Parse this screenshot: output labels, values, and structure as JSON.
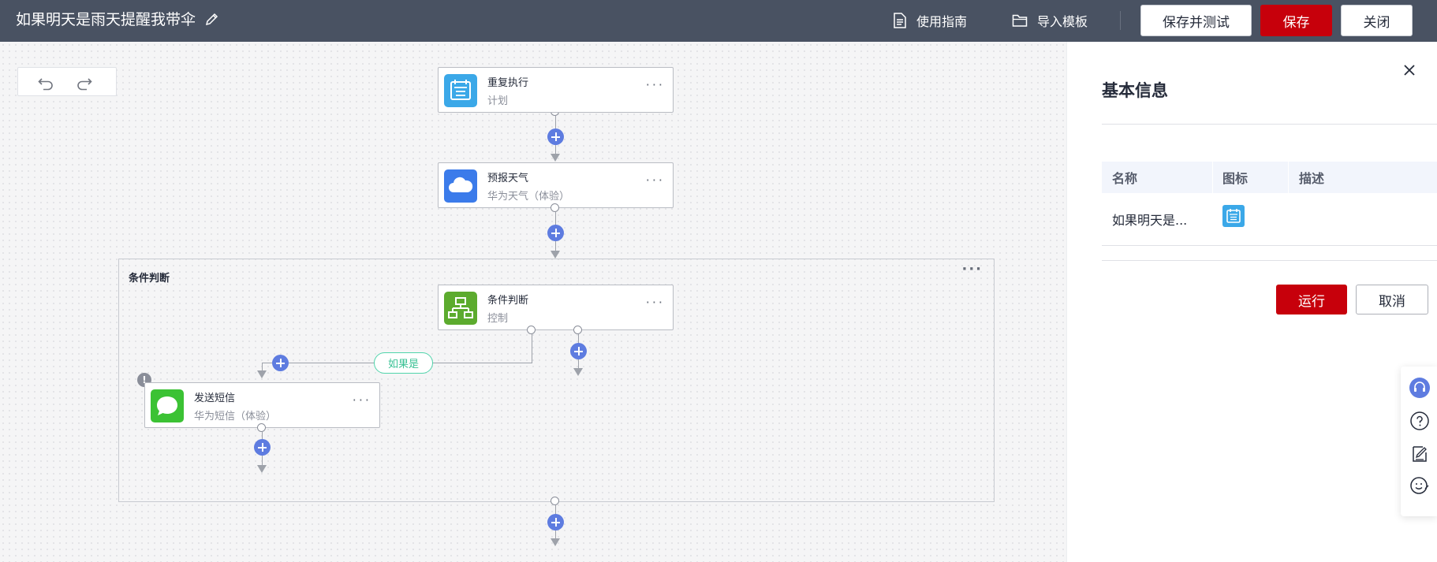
{
  "header": {
    "title": "如果明天是雨天提醒我带伞",
    "guide_label": "使用指南",
    "import_label": "导入模板",
    "save_test_label": "保存并测试",
    "save_label": "保存",
    "close_label": "关闭"
  },
  "colors": {
    "topbar": "#495262",
    "primary": "#c7000b",
    "plus": "#5e7ce0",
    "branch": "#3ac295"
  },
  "flow": {
    "nodes": [
      {
        "title": "重复执行",
        "subtitle": "计划",
        "icon": "calendar-icon",
        "color": "#3ba8e8"
      },
      {
        "title": "预报天气",
        "subtitle": "华为天气（体验）",
        "icon": "cloud-icon",
        "color": "#3b7bea"
      },
      {
        "title": "条件判断",
        "subtitle": "控制",
        "icon": "flowchart-icon",
        "color": "#5cab2e"
      },
      {
        "title": "发送短信",
        "subtitle": "华为短信（体验）",
        "icon": "message-icon",
        "color": "#3bc234"
      }
    ],
    "group_title": "条件判断",
    "branch_label": "如果是",
    "more_label": "···"
  },
  "panel": {
    "title": "基本信息",
    "columns": [
      "名称",
      "图标",
      "描述"
    ],
    "row": {
      "name": "如果明天是...",
      "icon": "calendar-icon",
      "description": ""
    },
    "run_label": "运行",
    "cancel_label": "取消"
  },
  "side_tools": [
    "headset-icon",
    "help-icon",
    "feedback-icon",
    "smile-icon"
  ]
}
